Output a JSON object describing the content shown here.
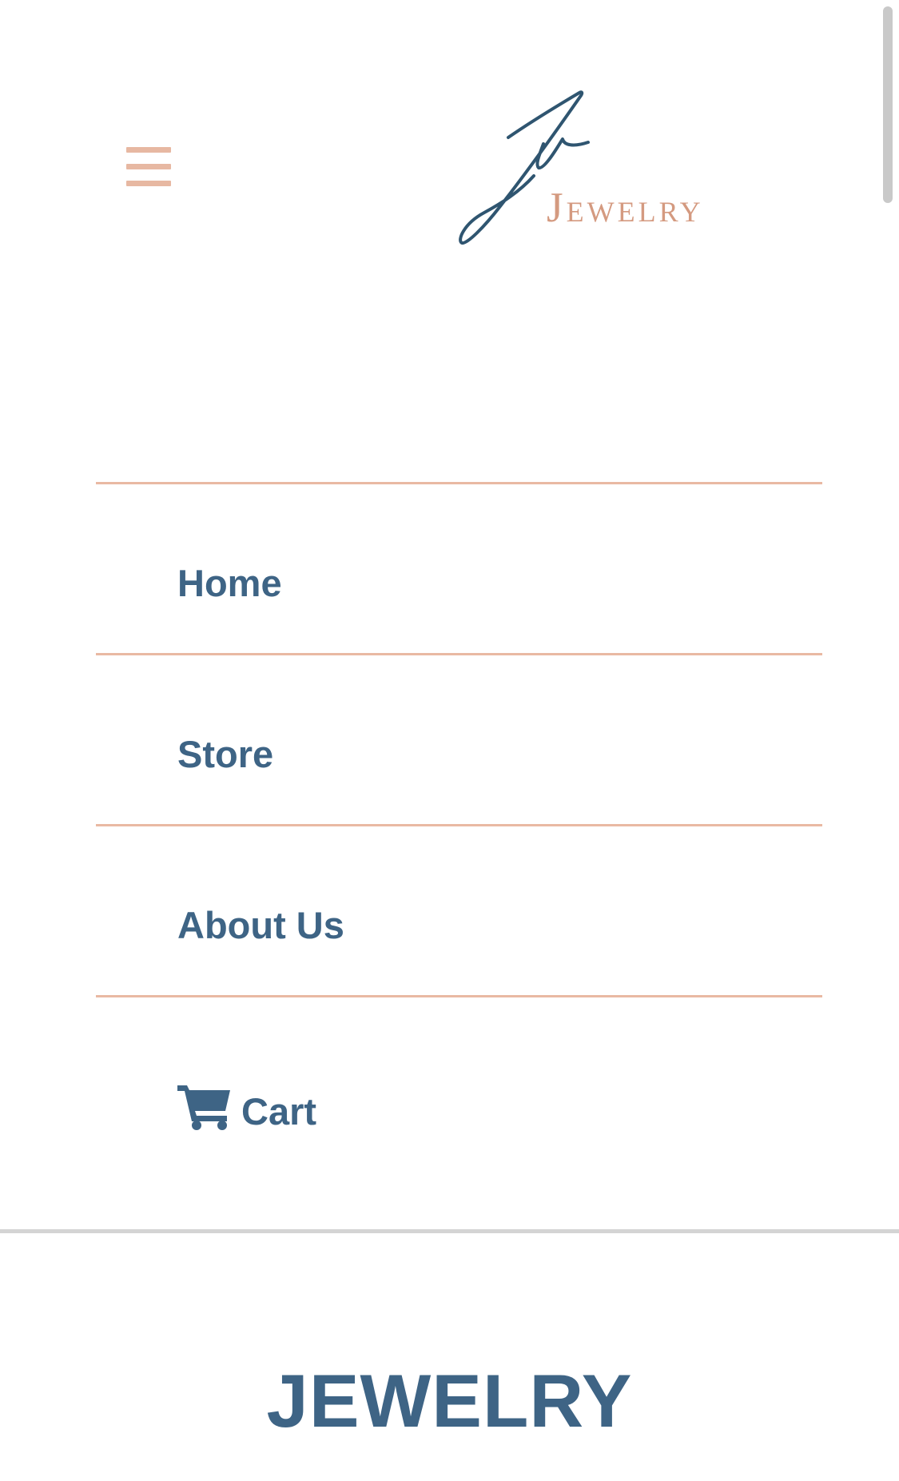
{
  "header": {
    "menu_icon": "hamburger-menu-icon",
    "logo": {
      "word": "JEWELRY",
      "monogram_color": "#2f5570",
      "word_color": "#d49a80"
    }
  },
  "nav": {
    "items": [
      {
        "label": "Home"
      },
      {
        "label": "Store"
      },
      {
        "label": "About Us"
      },
      {
        "label": "Cart",
        "icon": "shopping-cart-icon"
      }
    ]
  },
  "main": {
    "heading": "JEWELRY"
  },
  "colors": {
    "accent": "#e9b9a3",
    "text": "#3e6485",
    "divider": "#d4d4d4",
    "background": "#ffffff"
  }
}
